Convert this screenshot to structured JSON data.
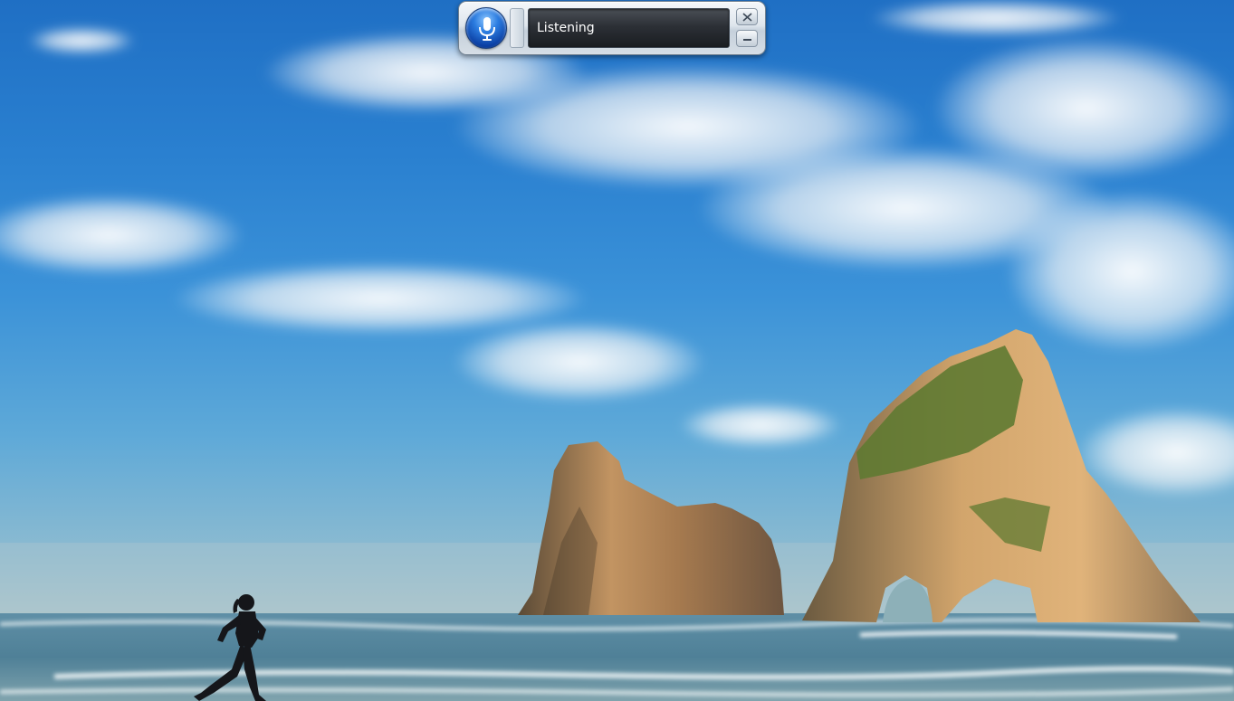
{
  "speech_bar": {
    "status": "Listening"
  },
  "icons": {
    "microphone": "microphone-icon",
    "close": "close-icon",
    "minimize": "minimize-icon"
  },
  "colors": {
    "mic_blue": "#1f5fc9",
    "status_bg": "#22262b",
    "status_text": "#ffffff"
  }
}
